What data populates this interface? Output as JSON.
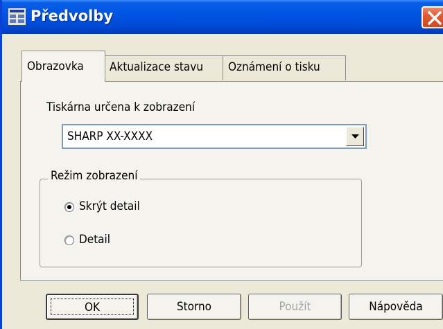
{
  "window": {
    "title": "Předvolby",
    "icons": {
      "app": "app-window-icon",
      "close": "close-x-icon"
    },
    "colors": {
      "titlebar": "#0054e3",
      "close": "#e25a33",
      "face": "#ece9d8"
    }
  },
  "tabs": [
    {
      "label": "Obrazovka",
      "active": true
    },
    {
      "label": "Aktualizace stavu",
      "active": false
    },
    {
      "label": "Oznámení o tisku",
      "active": false
    }
  ],
  "printer": {
    "label": "Tiskárna určena k zobrazení",
    "selected": "SHARP XX-XXXX",
    "dropdown_icon": "chevron-down-icon"
  },
  "display_mode": {
    "title": "Režim zobrazení",
    "options": [
      {
        "label": "Skrýt detail",
        "checked": true
      },
      {
        "label": "Detail",
        "checked": false
      }
    ]
  },
  "buttons": {
    "ok": "OK",
    "cancel": "Storno",
    "apply": "Použít",
    "help": "Nápověda"
  }
}
